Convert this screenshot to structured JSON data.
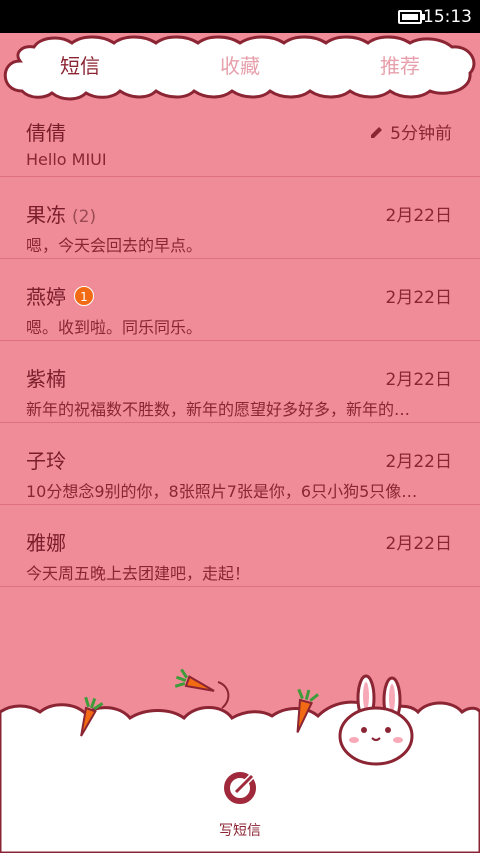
{
  "status": {
    "time": "15:13"
  },
  "tabs": [
    {
      "label": "短信"
    },
    {
      "label": "收藏"
    },
    {
      "label": "推荐"
    }
  ],
  "threads": [
    {
      "name": "倩倩",
      "snippet": "Hello MIUI",
      "date": "5分钟前"
    },
    {
      "name": "果冻",
      "count": "(2)",
      "snippet": "嗯，今天会回去的早点。",
      "date": "2月22日"
    },
    {
      "name": "燕婷",
      "badge": "1",
      "snippet": "嗯。收到啦。同乐同乐。",
      "date": "2月22日"
    },
    {
      "name": "紫楠",
      "snippet": "新年的祝福数不胜数，新年的愿望好多好多，新年的…",
      "date": "2月22日"
    },
    {
      "name": "子玲",
      "snippet": "10分想念9别的你，8张照片7张是你，6只小狗5只像…",
      "date": "2月22日"
    },
    {
      "name": "雅娜",
      "snippet": "今天周五晚上去团建吧，走起！",
      "date": "2月22日"
    }
  ],
  "compose": {
    "label": "写短信"
  }
}
